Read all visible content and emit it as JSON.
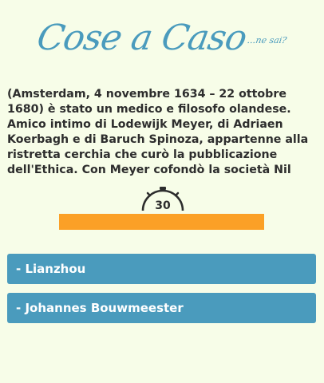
{
  "brand": {
    "logo_main": "Cose a Caso",
    "logo_sub": "...ne sai?",
    "color": "#4a9bbd"
  },
  "question": {
    "text": "(Amsterdam, 4 novembre 1634 – 22 ottobre 1680) è stato un medico e filosofo olandese. Amico intimo di Lodewijk Meyer, di Adriaen Koerbagh e di Baruch Spinoza, appartenne alla ristretta cerchia che curò la pubblicazione dell'Ethica. Con Meyer cofondò la società Nil"
  },
  "timer": {
    "icon": "stopwatch-icon",
    "seconds": "30",
    "progress_fraction": 1.0,
    "progress_color": "#fba026"
  },
  "answers": [
    {
      "label": "- Lianzhou"
    },
    {
      "label": "- Johannes Bouwmeester"
    }
  ]
}
